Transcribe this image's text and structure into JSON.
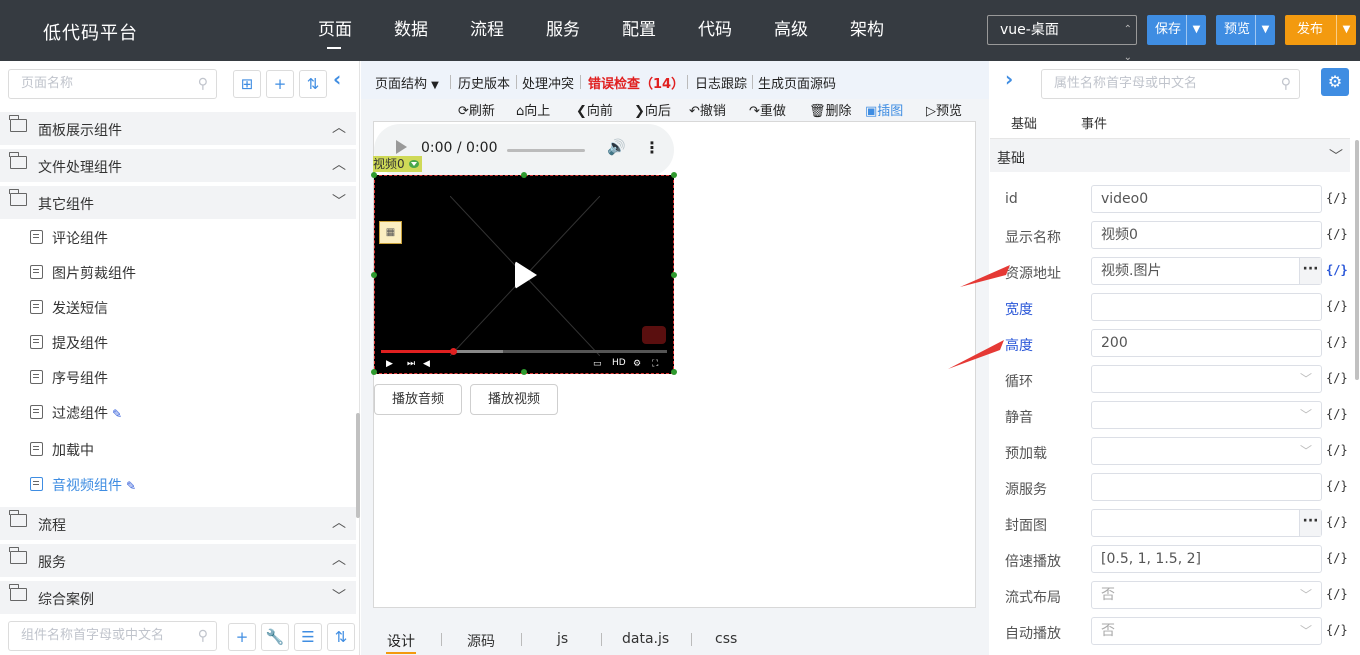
{
  "header": {
    "brand": "低代码平台",
    "nav": [
      "页面",
      "数据",
      "流程",
      "服务",
      "配置",
      "代码",
      "高级",
      "架构"
    ],
    "env_value": "vue-桌面",
    "save_label": "保存",
    "preview_label": "预览",
    "publish_label": "发布"
  },
  "left": {
    "search_placeholder": "页面名称",
    "groups_top": [
      {
        "label": "面板展示组件",
        "state": "collapsed"
      },
      {
        "label": "文件处理组件",
        "state": "collapsed"
      },
      {
        "label": "其它组件",
        "state": "expanded"
      }
    ],
    "items": [
      "评论组件",
      "图片剪裁组件",
      "发送短信",
      "提及组件",
      "序号组件",
      "过滤组件",
      "加载中",
      "音视频组件"
    ],
    "active_item": "音视频组件",
    "groups_bottom": [
      {
        "label": "流程",
        "state": "collapsed"
      },
      {
        "label": "服务",
        "state": "collapsed"
      },
      {
        "label": "综合案例",
        "state": "expanded"
      }
    ],
    "component_search_placeholder": "组件名称首字母或中文名"
  },
  "center": {
    "toolbar": {
      "structure": "页面结构",
      "history": "历史版本",
      "conflict": "处理冲突",
      "error_check": "错误检查（14）",
      "log": "日志跟踪",
      "gen_source": "生成页面源码"
    },
    "actions": {
      "refresh": "刷新",
      "up": "向上",
      "forward": "向前",
      "backward": "向后",
      "undo": "撤销",
      "redo": "重做",
      "delete": "删除",
      "insert": "插图",
      "preview": "预览"
    },
    "audio_time": "0:00 / 0:00",
    "video_tag": "视频0",
    "video_hd": "HD",
    "buttons": [
      "播放音频",
      "播放视频"
    ],
    "tabs": [
      "设计",
      "源码",
      "js",
      "data.js",
      "css"
    ],
    "active_tab": "设计"
  },
  "right": {
    "search_placeholder": "属性名称首字母或中文名",
    "tabs": [
      "基础",
      "事件"
    ],
    "section": "基础",
    "rows": [
      {
        "label": "id",
        "value": "video0",
        "type": "text"
      },
      {
        "label": "显示名称",
        "value": "视频0",
        "type": "text"
      },
      {
        "label": "资源地址",
        "value": "视频.图片",
        "type": "dots"
      },
      {
        "label": "宽度",
        "value": "",
        "type": "text"
      },
      {
        "label": "高度",
        "value": "200",
        "type": "text"
      },
      {
        "label": "循环",
        "value": "",
        "type": "select"
      },
      {
        "label": "静音",
        "value": "",
        "type": "select"
      },
      {
        "label": "预加载",
        "value": "",
        "type": "select"
      },
      {
        "label": "源服务",
        "value": "",
        "type": "text"
      },
      {
        "label": "封面图",
        "value": "",
        "type": "dots"
      },
      {
        "label": "倍速播放",
        "value": "[0.5, 1, 1.5, 2]",
        "type": "text"
      },
      {
        "label": "流式布局",
        "value": "否",
        "type": "select"
      },
      {
        "label": "自动播放",
        "value": "否",
        "type": "select"
      }
    ],
    "curly": "{/}"
  },
  "colors": {
    "topbar": "#363b41",
    "accent": "#3f8de2",
    "publish": "#f39a0f",
    "error": "#e02020",
    "annotation_arrow": "#e53935"
  }
}
